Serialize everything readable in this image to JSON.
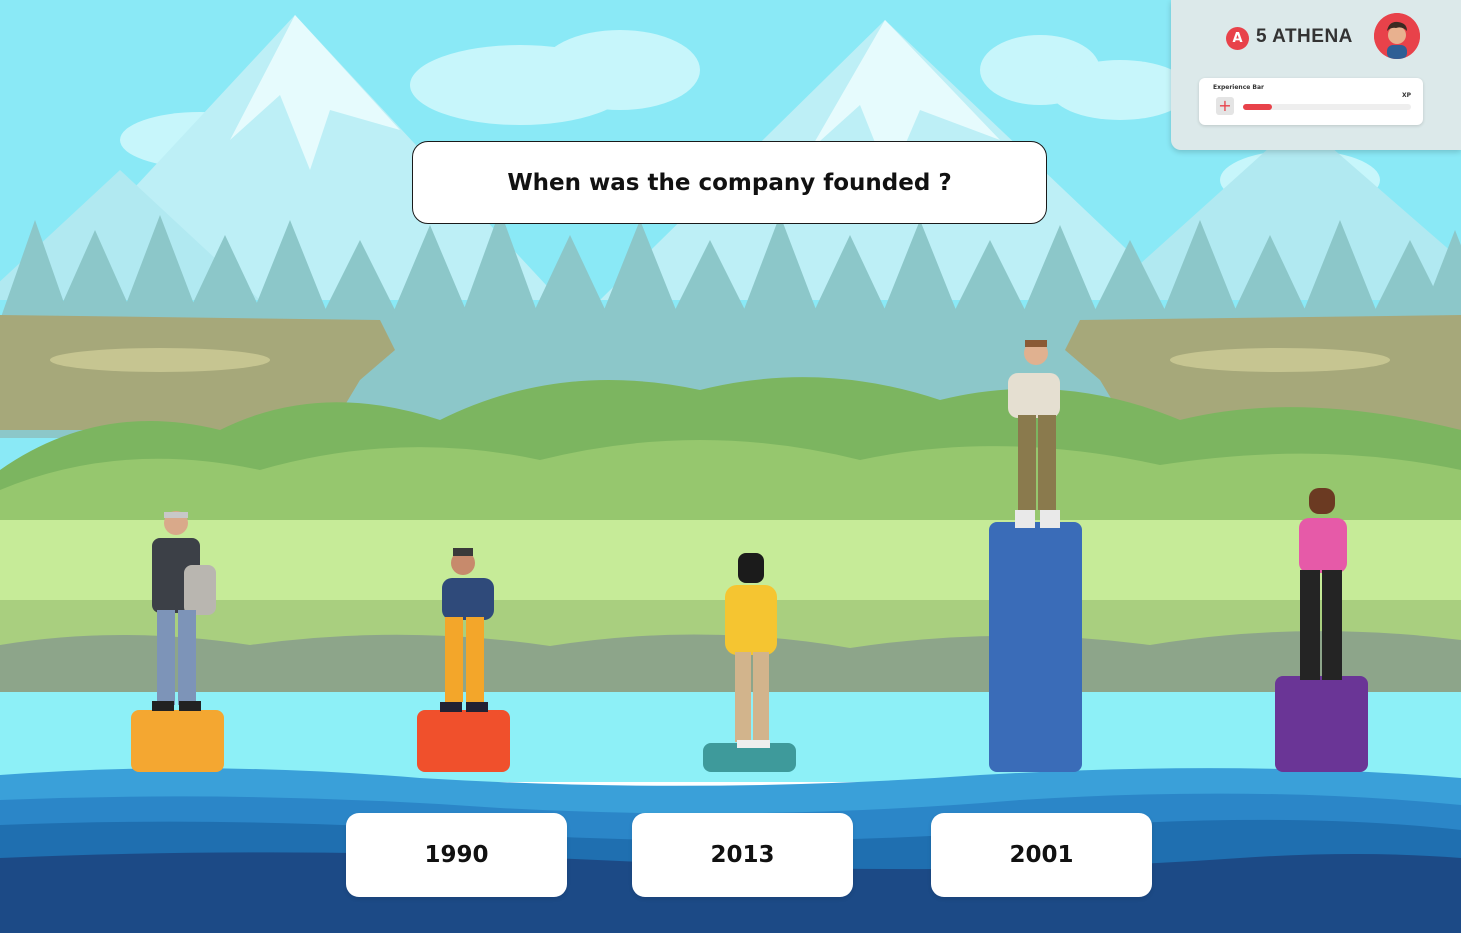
{
  "question": {
    "text": "When was the company founded ?"
  },
  "player": {
    "badge_letter": "A",
    "name": "5 ATHENA",
    "avatar_icon": "boy-avatar-icon",
    "xp_label": "Experience Bar",
    "xp_unit": "XP",
    "xp_plus": "+",
    "xp_progress": 0.17
  },
  "answers": [
    {
      "label": "1990"
    },
    {
      "label": "2013"
    },
    {
      "label": "2001"
    }
  ],
  "podiums": [
    {
      "color": "#f4a731",
      "character": "older-man-figure"
    },
    {
      "color": "#f0502c",
      "character": "boy-figure"
    },
    {
      "color": "#3e9a9b",
      "character": "girl-yellow-sweater-figure"
    },
    {
      "color": "#3a6cb8",
      "character": "man-glasses-figure"
    },
    {
      "color": "#6a3596",
      "character": "woman-pink-shirt-figure"
    }
  ],
  "colors": {
    "sky": "#7ce8f5",
    "river": "#8df0f7",
    "accent": "#e8424a"
  }
}
